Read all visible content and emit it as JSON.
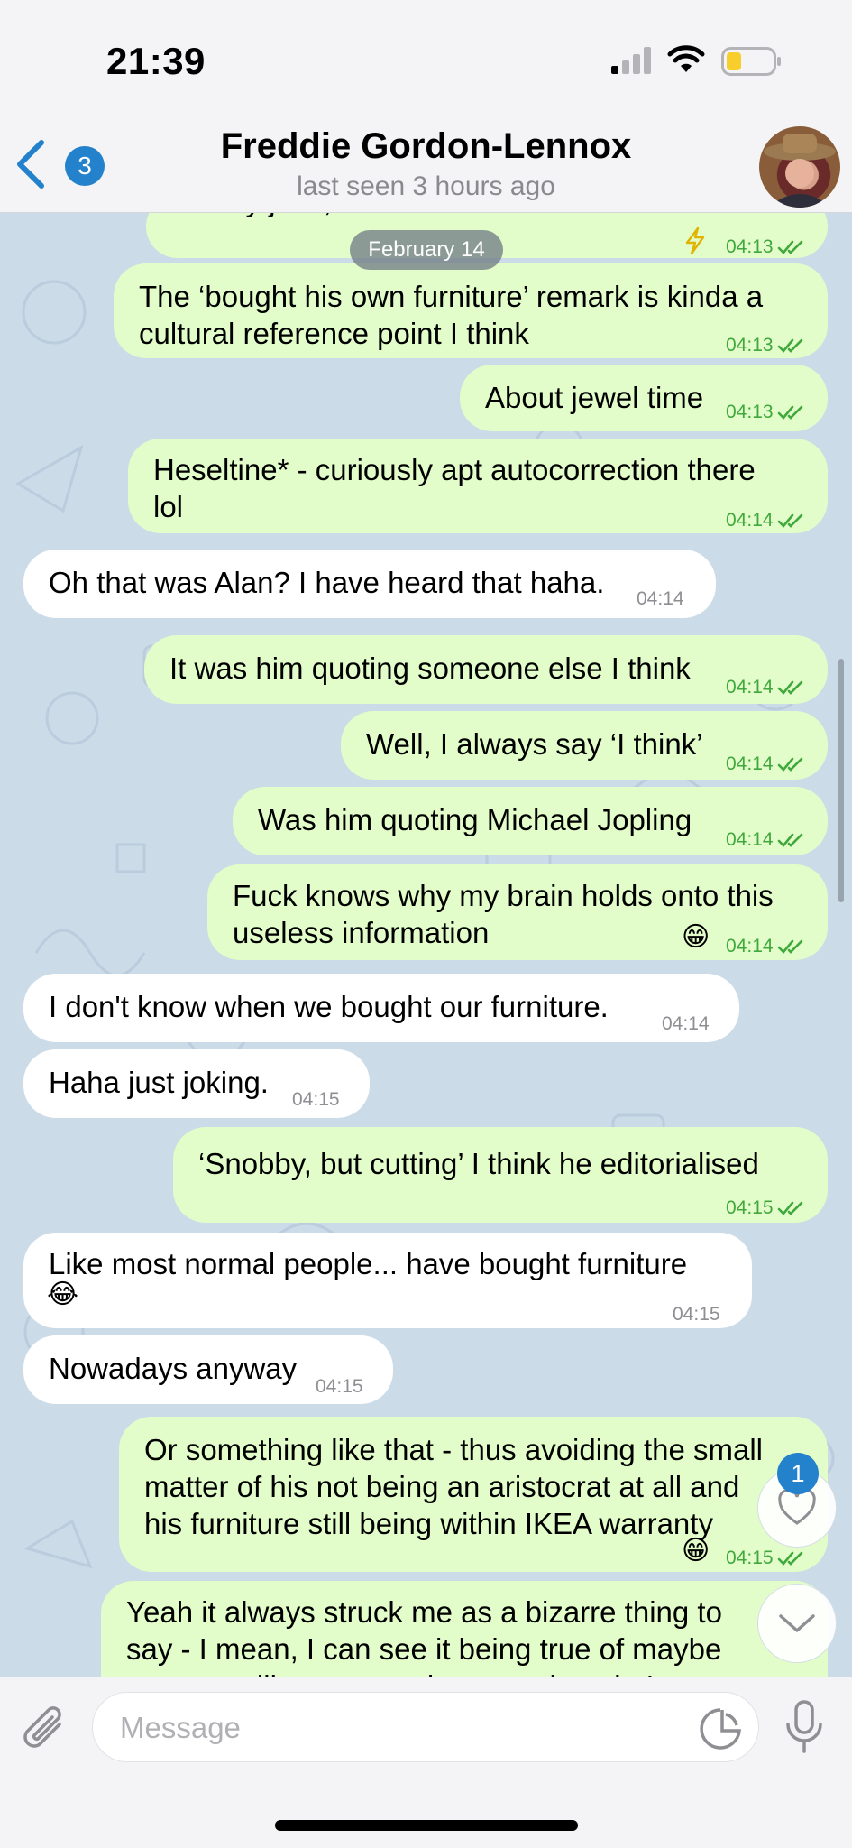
{
  "status_bar": {
    "time": "21:39"
  },
  "header": {
    "unread_count": "3",
    "contact_name": "Freddie Gordon-Lennox",
    "last_seen": "last seen 3 hours ago"
  },
  "date_separator": "February 14",
  "messages": [
    {
      "dir": "out",
      "lines": [
        "not my joke, I think he was kinda called that"
      ],
      "time": "04:13",
      "status": "read",
      "emoji": ""
    },
    {
      "dir": "out",
      "lines": [
        "The ‘bought his own furniture’ remark is kinda a",
        "cultural reference point I think"
      ],
      "time": "04:13",
      "status": "read",
      "emoji": ""
    },
    {
      "dir": "out",
      "lines": [
        "About jewel time"
      ],
      "time": "04:13",
      "status": "read",
      "emoji": ""
    },
    {
      "dir": "out",
      "lines": [
        "Heseltine* - curiously apt autocorrection there",
        "lol"
      ],
      "time": "04:14",
      "status": "read",
      "emoji": ""
    },
    {
      "dir": "in",
      "lines": [
        "Oh that was Alan? I have heard that haha."
      ],
      "time": "04:14",
      "emoji": ""
    },
    {
      "dir": "out",
      "lines": [
        "It was him quoting someone else I think"
      ],
      "time": "04:14",
      "status": "read",
      "emoji": ""
    },
    {
      "dir": "out",
      "lines": [
        "Well, I always say ‘I think’"
      ],
      "time": "04:14",
      "status": "read",
      "emoji": ""
    },
    {
      "dir": "out",
      "lines": [
        "Was him quoting Michael Jopling"
      ],
      "time": "04:14",
      "status": "read",
      "emoji": ""
    },
    {
      "dir": "out",
      "lines": [
        "Fuck knows why my brain holds onto this",
        "useless information"
      ],
      "time": "04:14",
      "status": "read",
      "emoji": "😁"
    },
    {
      "dir": "in",
      "lines": [
        "I don't know when we bought our furniture."
      ],
      "time": "04:14",
      "emoji": ""
    },
    {
      "dir": "in",
      "lines": [
        "Haha just joking."
      ],
      "time": "04:15",
      "emoji": ""
    },
    {
      "dir": "out",
      "lines": [
        "‘Snobby, but cutting’ I think he editorialised"
      ],
      "time": "04:15",
      "status": "read",
      "emoji": ""
    },
    {
      "dir": "in",
      "lines": [
        "Like most normal people... have bought furniture"
      ],
      "time": "04:15",
      "emoji": "😂"
    },
    {
      "dir": "in",
      "lines": [
        "Nowadays anyway"
      ],
      "time": "04:15",
      "emoji": ""
    },
    {
      "dir": "out",
      "lines": [
        "Or something like that - thus avoiding the small",
        "matter of his not being an aristocrat at all and",
        "his furniture still being within IKEA warranty"
      ],
      "time": "04:15",
      "status": "read",
      "emoji": "😁"
    },
    {
      "dir": "out",
      "lines": [
        "Yeah it always struck me as a bizarre thing to",
        "say - I mean, I can see it being true of maybe",
        "someone like my grandma, not that she'"
      ],
      "time": "",
      "status": "",
      "emoji": ""
    }
  ],
  "reactions_badge": "1",
  "composer": {
    "placeholder": "Message"
  },
  "icons": {
    "back": "chevron-left-icon",
    "signal": "signal-icon",
    "wifi": "wifi-icon",
    "battery": "battery-icon",
    "attach": "paperclip-icon",
    "sticker": "sticker-icon",
    "mic": "microphone-icon",
    "heart": "heart-icon",
    "scroll_down": "chevron-down-icon",
    "bolt": "lightning-icon"
  },
  "colors": {
    "accent": "#2481cc",
    "outgoing_bubble": "#e2fdc9",
    "incoming_bubble": "#ffffff",
    "read_check": "#40a83c",
    "chat_background": "#cbdbe8"
  }
}
